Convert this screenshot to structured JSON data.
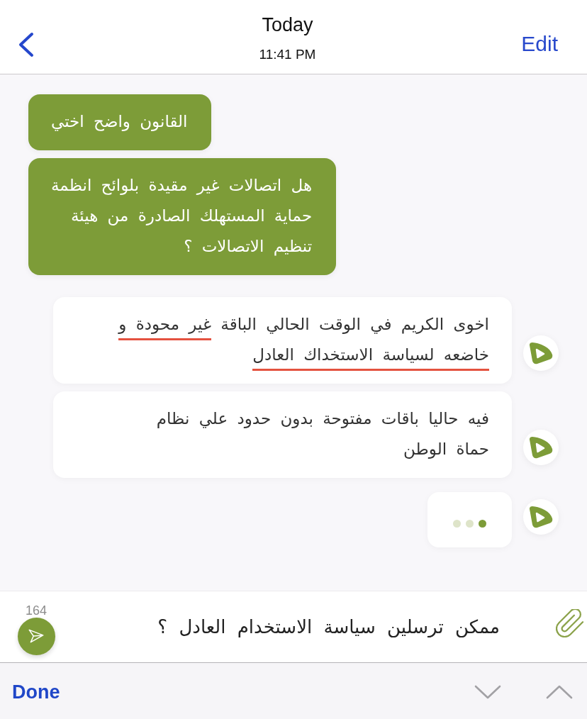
{
  "header": {
    "title": "Today",
    "subtitle": "11:41 PM",
    "edit_label": "Edit"
  },
  "messages": [
    {
      "kind": "sent",
      "lines": [
        [
          {
            "text": "القانون واضح اختي",
            "underlined": false
          }
        ]
      ]
    },
    {
      "kind": "sent",
      "lines": [
        [
          {
            "text": "هل اتصالات غير مقيدة بلوائح انظمة",
            "underlined": false
          }
        ],
        [
          {
            "text": "حماية المستهلك الصادرة من هيئة",
            "underlined": false
          }
        ],
        [
          {
            "text": "تنظيم الاتصالات ؟",
            "underlined": false
          }
        ]
      ]
    },
    {
      "kind": "received",
      "lines": [
        [
          {
            "text": "اخوى الكريم في الوقت الحالي الباقة ",
            "underlined": false
          },
          {
            "text": "غير محودة و",
            "underlined": true
          }
        ],
        [
          {
            "text": "خاضعه لسياسة الاستخداك العادل",
            "underlined": true
          }
        ]
      ]
    },
    {
      "kind": "received",
      "lines": [
        [
          {
            "text": "فيه حاليا باقات مفتوحة بدون حدود علي نظام",
            "underlined": false
          }
        ],
        [
          {
            "text": "حماة الوطن",
            "underlined": false
          }
        ]
      ]
    },
    {
      "kind": "typing",
      "dots": [
        {
          "active": false
        },
        {
          "active": false
        },
        {
          "active": true
        }
      ]
    }
  ],
  "composer": {
    "counter": "164",
    "value": "ممكن ترسلين سياسة الاستخدام العادل ؟"
  },
  "toolbar": {
    "done_label": "Done",
    "arrows": [
      {
        "kind": "down",
        "disabled": true
      },
      {
        "kind": "up",
        "disabled": true
      }
    ]
  }
}
